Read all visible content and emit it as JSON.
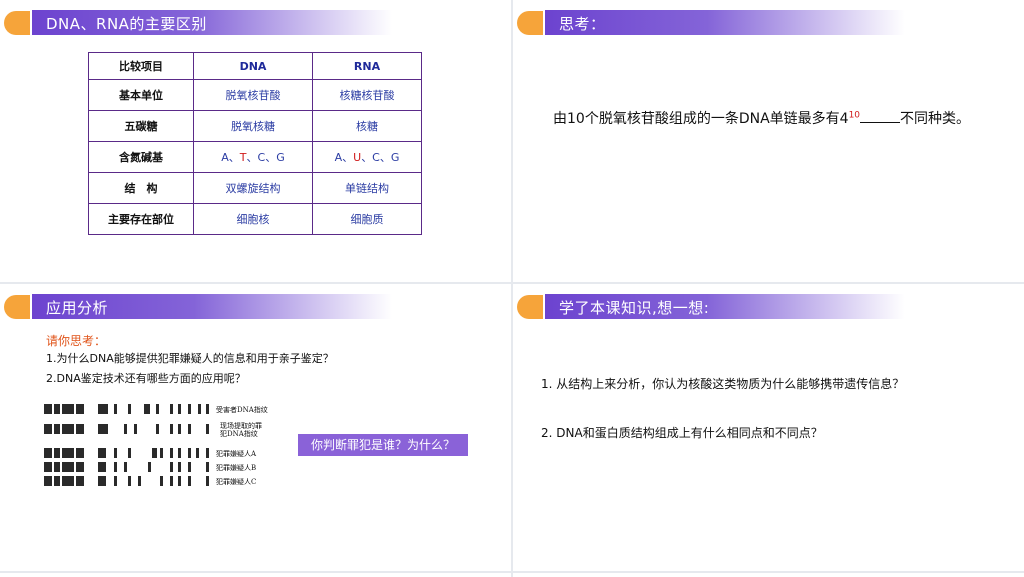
{
  "slide1": {
    "title": "DNA、RNA的主要区别",
    "table": {
      "headers": [
        "比较项目",
        "DNA",
        "RNA"
      ],
      "rows": [
        {
          "label": "基本单位",
          "dna": "脱氧核苷酸",
          "rna": "核糖核苷酸"
        },
        {
          "label": "五碳糖",
          "dna": "脱氧核糖",
          "rna": "核糖"
        },
        {
          "label": "含氮碱基",
          "dna_parts": [
            "A、",
            "T",
            "、C、G"
          ],
          "rna_parts": [
            "A、",
            "U",
            "、C、G"
          ]
        },
        {
          "label": "结　构",
          "dna": "双螺旋结构",
          "rna": "单链结构"
        },
        {
          "label": "主要存在部位",
          "dna": "细胞核",
          "rna": "细胞质"
        }
      ]
    }
  },
  "slide2": {
    "title": "思考：",
    "question_pre": "由10个脱氧核苷酸组成的一条DNA单链最多有4",
    "question_sup": "10",
    "question_post": "不同种类。"
  },
  "slide3": {
    "title": "应用分析",
    "think_label": "请你思考：",
    "q1": "1.为什么DNA能够提供犯罪嫌疑人的信息和用于亲子鉴定？",
    "q2": "2.DNA鉴定技术还有哪些方面的应用呢？",
    "fingerprint_labels": [
      "受害者DNA指纹",
      "现场提取的罪",
      "犯DNA指纹",
      "犯罪嫌疑人A",
      "犯罪嫌疑人B",
      "犯罪嫌疑人C"
    ],
    "judge_prompt": "你判断罪犯是谁？为什么？"
  },
  "slide4": {
    "title": "学了本课知识,想一想:",
    "q1": "1. 从结构上来分析，你认为核酸这类物质为什么能够携带遗传信息？",
    "q2": "2. DNA和蛋白质结构组成上有什么相同点和不同点？"
  },
  "colors": {
    "accent_orange": "#f6a43a",
    "title_purple": "#6c43cf",
    "table_border": "#5a2a88",
    "highlight_red": "#d01a1a"
  }
}
